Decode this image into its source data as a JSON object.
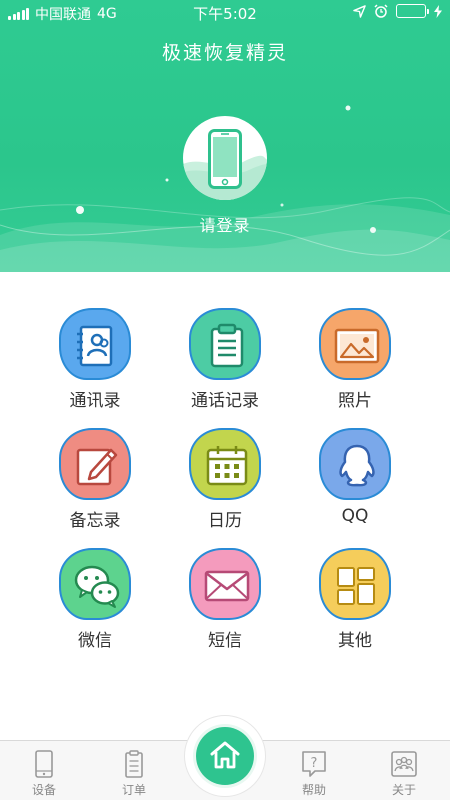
{
  "status_bar": {
    "carrier": "中国联通",
    "network": "4G",
    "time": "下午5:02"
  },
  "header": {
    "title": "极速恢复精灵",
    "login_label": "请登录",
    "avatar_icon": "phone-icon"
  },
  "grid": {
    "items": [
      {
        "label": "通讯录",
        "icon": "contacts-icon",
        "color": "#5aa8ee"
      },
      {
        "label": "通话记录",
        "icon": "clipboard-icon",
        "color": "#4dcca4"
      },
      {
        "label": "照片",
        "icon": "photo-icon",
        "color": "#f6a66a"
      },
      {
        "label": "备忘录",
        "icon": "edit-note-icon",
        "color": "#ef8c82"
      },
      {
        "label": "日历",
        "icon": "calendar-icon",
        "color": "#c2d54d"
      },
      {
        "label": "QQ",
        "icon": "qq-icon",
        "color": "#7aa8ea"
      },
      {
        "label": "微信",
        "icon": "wechat-icon",
        "color": "#5dd38e"
      },
      {
        "label": "短信",
        "icon": "envelope-icon",
        "color": "#f49bbd"
      },
      {
        "label": "其他",
        "icon": "grid-icon",
        "color": "#f5cd5b"
      }
    ]
  },
  "tabbar": {
    "items": [
      {
        "label": "设备",
        "icon": "device-icon"
      },
      {
        "label": "订单",
        "icon": "order-icon"
      },
      {
        "label": "",
        "icon": "home-icon",
        "color": "#2ec48f"
      },
      {
        "label": "帮助",
        "icon": "help-icon"
      },
      {
        "label": "关于",
        "icon": "about-icon"
      }
    ]
  }
}
